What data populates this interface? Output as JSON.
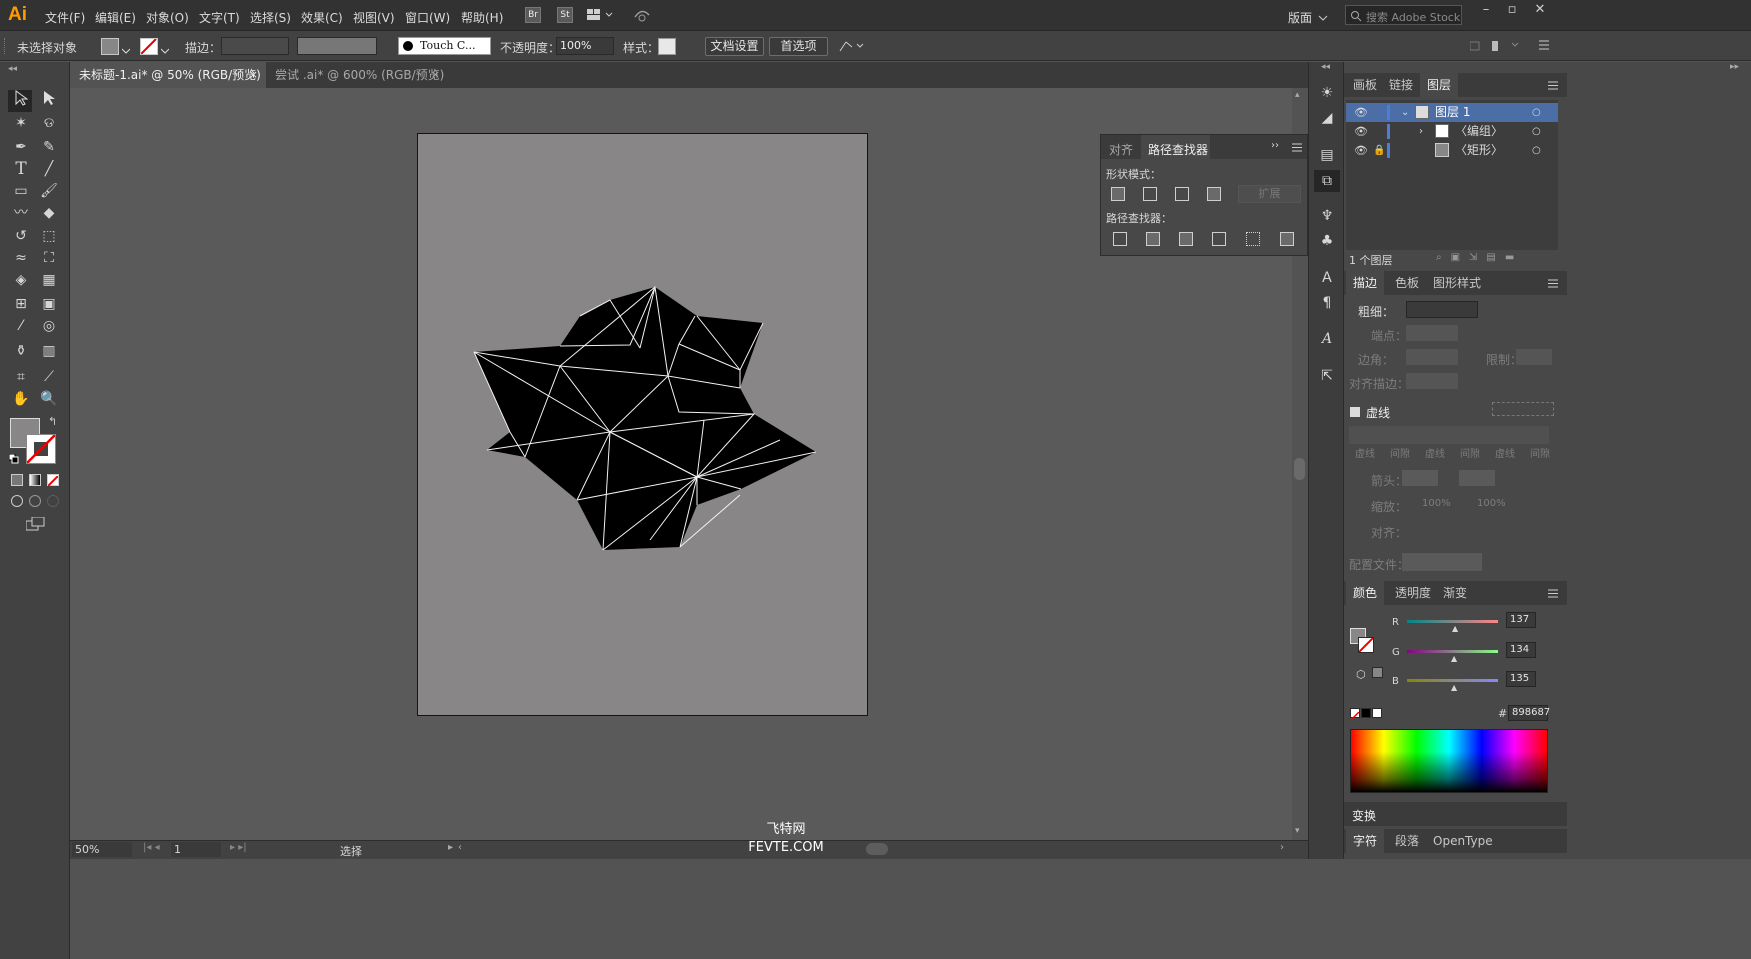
{
  "app": {
    "logo": "Ai",
    "colors": {
      "chrome": "#323232",
      "panel": "#484848",
      "artboard": "#898687",
      "accent": "#4b6ea6",
      "logo": "#ff9a00"
    }
  },
  "menu": {
    "items": [
      "文件(F)",
      "编辑(E)",
      "对象(O)",
      "文字(T)",
      "选择(S)",
      "效果(C)",
      "视图(V)",
      "窗口(W)",
      "帮助(H)"
    ],
    "br": "Br",
    "st": "St",
    "workspace": "版面",
    "search_placeholder": "搜索 Adobe Stock"
  },
  "control": {
    "selection": "未选择对象",
    "stroke_label": "描边：",
    "brush": "Touch C...",
    "opacity_label": "不透明度：",
    "opacity": "100%",
    "style_label": "样式：",
    "doc_setup": "文档设置",
    "prefs": "首选项"
  },
  "tabs": [
    {
      "label": "未标题-1.ai* @ 50% (RGB/预览)",
      "active": true,
      "close": "×"
    },
    {
      "label": "尝试 .ai* @ 600% (RGB/预览)",
      "active": false,
      "close": "×"
    }
  ],
  "status": {
    "zoom": "50%",
    "page": "1",
    "tool": "选择"
  },
  "watermark": {
    "line1": "飞特网",
    "line2": "FEVTE.COM"
  },
  "pathfinder": {
    "tab_align": "对齐",
    "tab_pf": "路径查找器",
    "shape_modes": "形状模式：",
    "pathfinders": "路径查找器：",
    "expand": "扩展"
  },
  "layers": {
    "tabs": [
      "画板",
      "链接",
      "图层"
    ],
    "rows": [
      {
        "name": "图层 1"
      },
      {
        "name": "〈编组〉"
      },
      {
        "name": "〈矩形〉"
      }
    ],
    "count": "1 个图层"
  },
  "stroke": {
    "tabs": [
      "描边",
      "色板",
      "图形样式"
    ],
    "weight": "粗细：",
    "cap": "端点：",
    "corner": "边角：",
    "limit": "限制：",
    "align": "对齐描边：",
    "dashed": "虚线",
    "dash_labels": [
      "虚线",
      "间隙",
      "虚线",
      "间隙",
      "虚线",
      "间隙"
    ],
    "arrows": "箭头：",
    "scale": "缩放：",
    "scale_vals": [
      "100%",
      "100%"
    ],
    "align2": "对齐：",
    "profile": "配置文件："
  },
  "color": {
    "tabs": [
      "颜色",
      "透明度",
      "渐变"
    ],
    "r_label": "R",
    "g_label": "G",
    "b_label": "B",
    "r": 137,
    "g": 134,
    "b": 135,
    "hash": "#",
    "hex": "898687",
    "fill": "#898687"
  },
  "bottom": {
    "transform": "变换",
    "char_tabs": [
      "字符",
      "段落",
      "OpenType"
    ]
  }
}
